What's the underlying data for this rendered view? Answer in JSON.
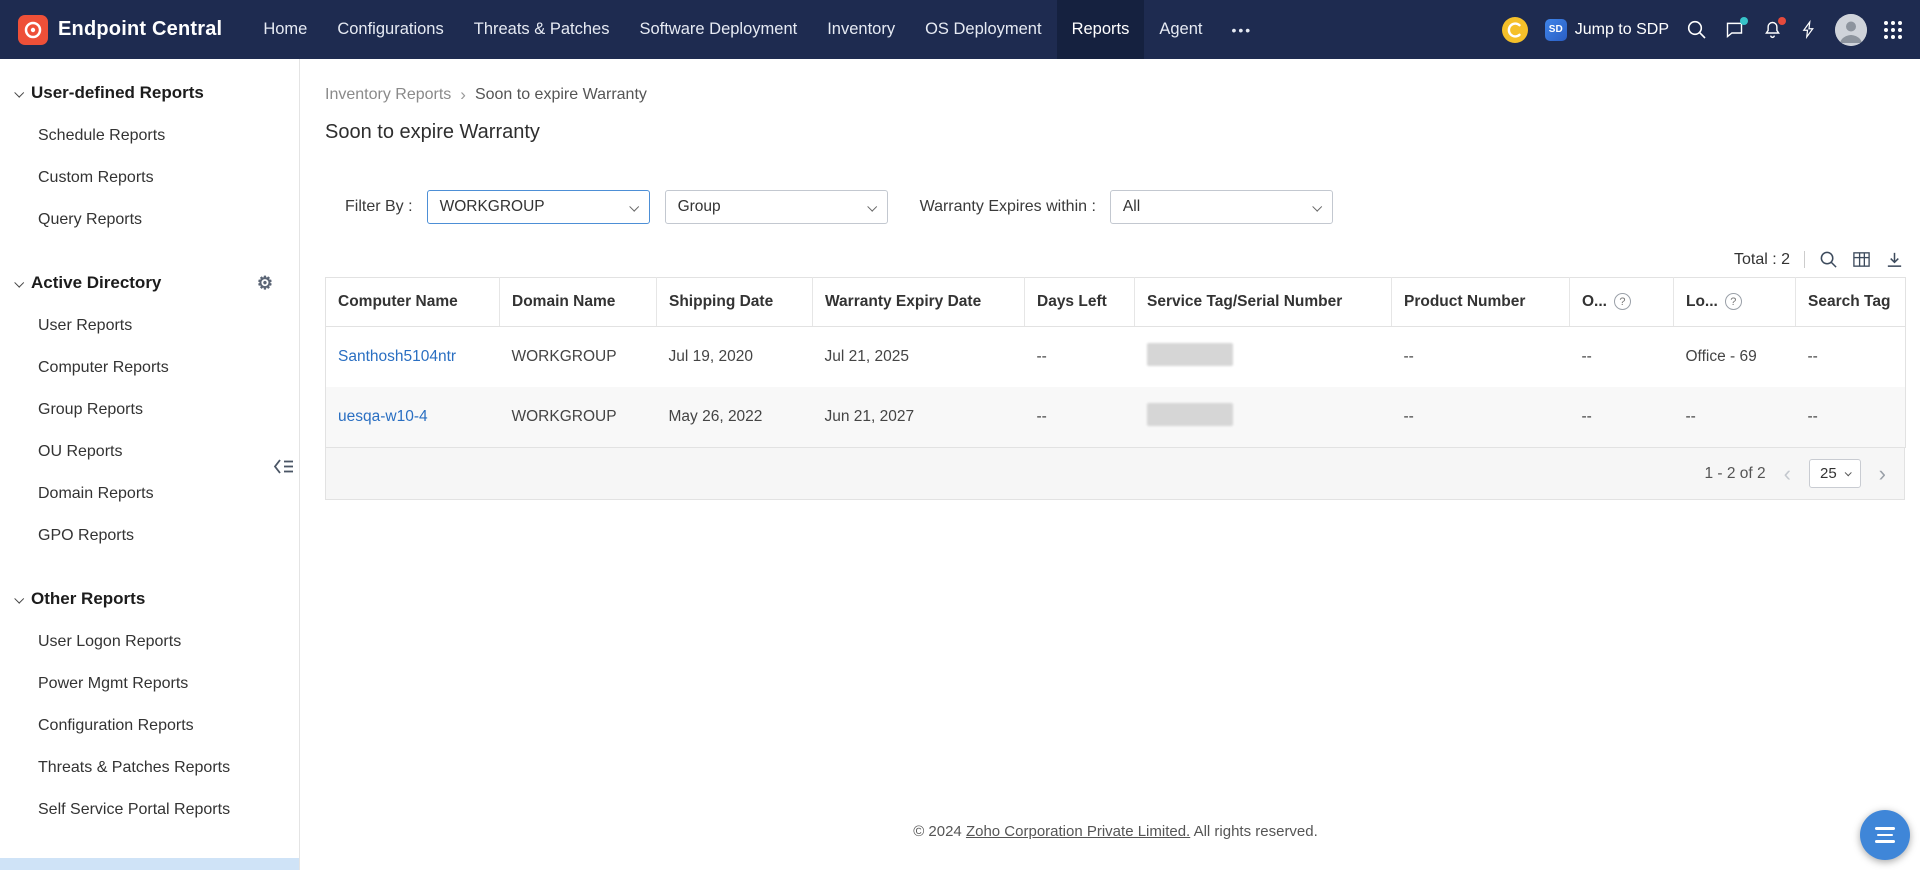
{
  "topbar": {
    "brand": "Endpoint Central",
    "nav": [
      {
        "label": "Home"
      },
      {
        "label": "Configurations"
      },
      {
        "label": "Threats & Patches"
      },
      {
        "label": "Software Deployment"
      },
      {
        "label": "Inventory"
      },
      {
        "label": "OS Deployment"
      },
      {
        "label": "Reports"
      },
      {
        "label": "Agent"
      }
    ],
    "sdp": {
      "logo_text": "SD",
      "label": "Jump to SDP"
    }
  },
  "glyphs": {
    "more": "•••",
    "gear": "⚙",
    "breadcrumb_sep": "›",
    "help": "?",
    "prev": "‹",
    "next": "›"
  },
  "sidebar": {
    "sections": [
      {
        "title": "User-defined Reports",
        "items": [
          {
            "label": "Schedule Reports"
          },
          {
            "label": "Custom Reports"
          },
          {
            "label": "Query Reports"
          }
        ]
      },
      {
        "title": "Active Directory",
        "items": [
          {
            "label": "User Reports"
          },
          {
            "label": "Computer Reports"
          },
          {
            "label": "Group Reports"
          },
          {
            "label": "OU Reports"
          },
          {
            "label": "Domain Reports"
          },
          {
            "label": "GPO Reports"
          }
        ]
      },
      {
        "title": "Other Reports",
        "items": [
          {
            "label": "User Logon Reports"
          },
          {
            "label": "Power Mgmt Reports"
          },
          {
            "label": "Configuration Reports"
          },
          {
            "label": "Threats & Patches Reports"
          },
          {
            "label": "Self Service Portal Reports"
          }
        ]
      }
    ]
  },
  "main": {
    "breadcrumb": {
      "parent": "Inventory Reports",
      "current": "Soon to expire Warranty"
    },
    "title": "Soon to expire Warranty",
    "filters": {
      "filter_by_label": "Filter By :",
      "scope_value": "WORKGROUP",
      "group_value": "Group",
      "warranty_label": "Warranty Expires within :",
      "warranty_value": "All"
    },
    "toolbar": {
      "total_label": "Total : 2"
    },
    "table": {
      "columns": [
        {
          "label": "Computer Name"
        },
        {
          "label": "Domain Name"
        },
        {
          "label": "Shipping Date"
        },
        {
          "label": "Warranty Expiry Date"
        },
        {
          "label": "Days Left"
        },
        {
          "label": "Service Tag/Serial Number"
        },
        {
          "label": "Product Number"
        },
        {
          "label": "O..."
        },
        {
          "label": "Lo..."
        },
        {
          "label": "Search Tag"
        }
      ],
      "rows": [
        {
          "computer_name": "Santhosh5104ntr",
          "domain_name": "WORKGROUP",
          "shipping_date": "Jul 19, 2020",
          "warranty_expiry_date": "Jul 21, 2025",
          "days_left": "--",
          "product_number": "--",
          "owner": "--",
          "location": "Office - 69",
          "search_tag": "--"
        },
        {
          "computer_name": "uesqa-w10-4",
          "domain_name": "WORKGROUP",
          "shipping_date": "May 26, 2022",
          "warranty_expiry_date": "Jun 21, 2027",
          "days_left": "--",
          "product_number": "--",
          "owner": "--",
          "location": "--",
          "search_tag": "--"
        }
      ]
    },
    "pagination": {
      "range_label": "1 - 2 of 2",
      "page_size": "25"
    },
    "footer": {
      "prefix": "© 2024 ",
      "link_text": "Zoho Corporation Private Limited.",
      "suffix": " All rights reserved."
    }
  }
}
